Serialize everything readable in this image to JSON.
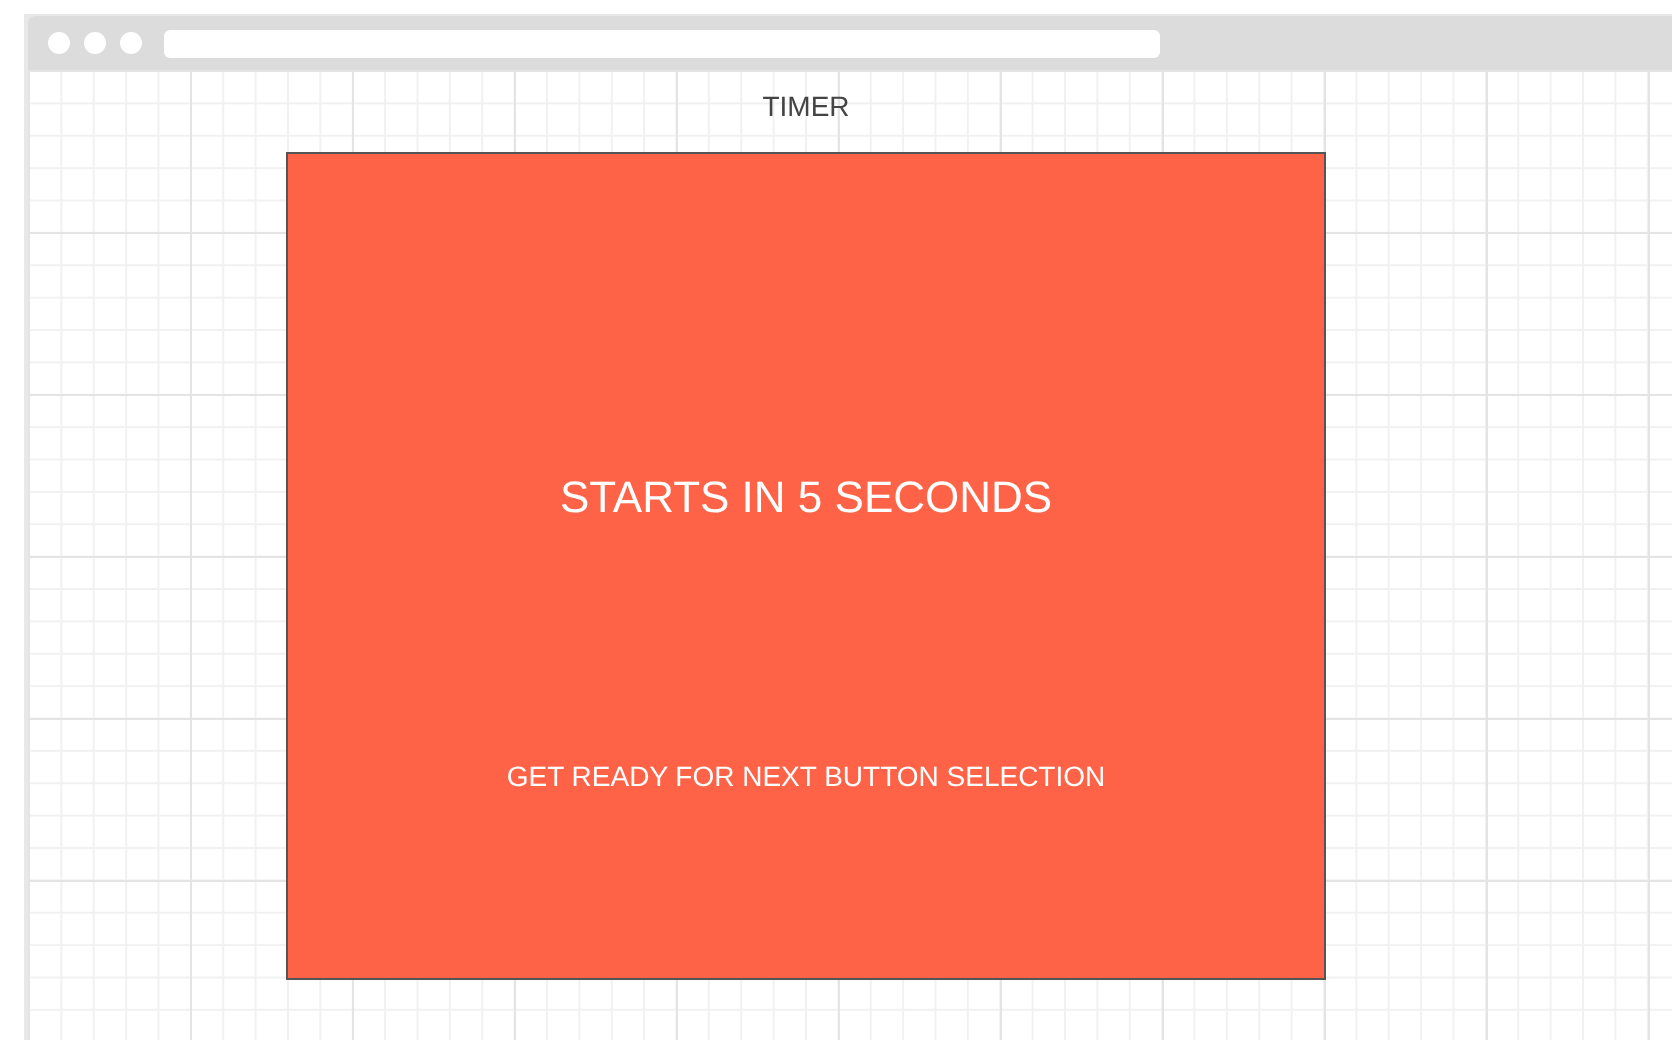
{
  "title": "TIMER",
  "panel": {
    "heading": "STARTS IN 5 SECONDS",
    "message": "GET READY FOR NEXT BUTTON SELECTION"
  }
}
